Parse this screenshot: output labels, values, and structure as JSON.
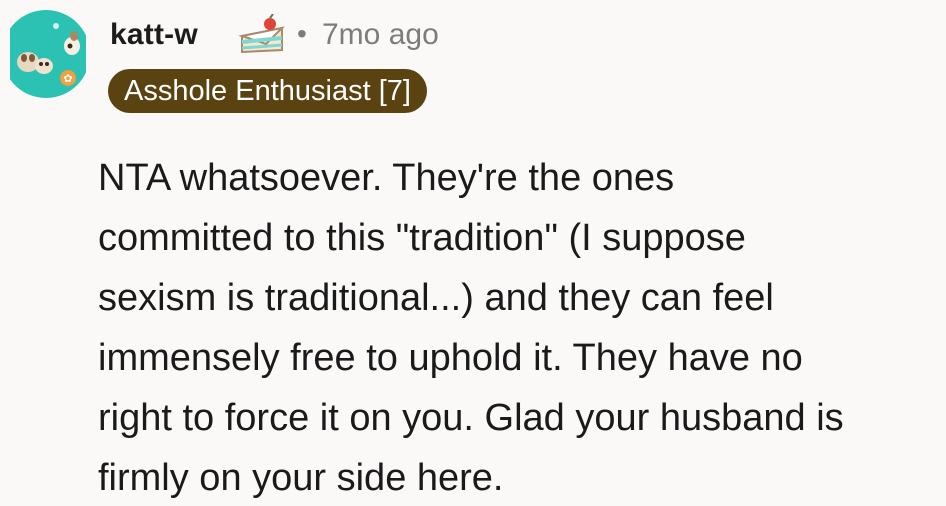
{
  "comment": {
    "username": "katt-w",
    "separator": "•",
    "timestamp": "7mo ago",
    "flair": "Asshole Enthusiast [7]",
    "award_icon": "cake-slice-icon",
    "avatar_icon": "cartoon-animals-avatar-icon",
    "body_lines": [
      "NTA whatsoever. They're the ones",
      "committed to this \"tradition\" (I suppose",
      "sexism is traditional...) and they can feel",
      "immensely free to uphold it. They have no",
      "right to force it on you. Glad your husband is",
      "firmly on your side here."
    ]
  },
  "colors": {
    "background": "#faf9f8",
    "flair_background": "#5a4211",
    "flair_text": "#ffffff",
    "meta_text": "#7c7c7c",
    "avatar_background": "#2bc2b3"
  }
}
